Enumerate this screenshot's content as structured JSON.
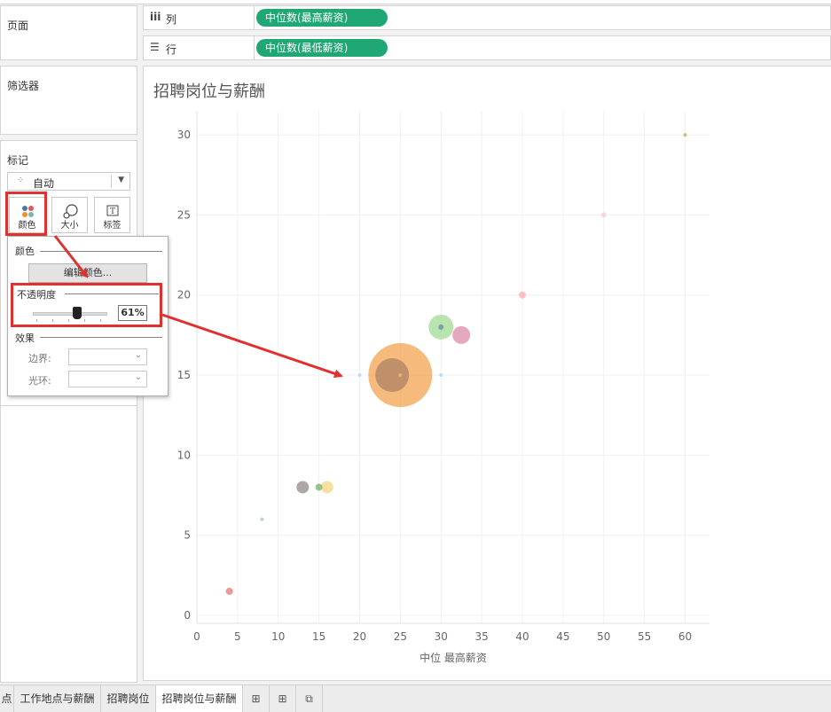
{
  "sidebar": {
    "pages_title": "页面",
    "filters_title": "筛选器",
    "marks_title": "标记",
    "mark_type": "自动",
    "buttons": [
      {
        "label": "颜色",
        "icon": "color-dots-icon"
      },
      {
        "label": "大小",
        "icon": "size-icon"
      },
      {
        "label": "标签",
        "icon": "label-T-icon"
      }
    ]
  },
  "shelves": {
    "columns": {
      "label": "列",
      "icon": "columns-icon",
      "pill": "中位数(最高薪资)"
    },
    "rows": {
      "label": "行",
      "icon": "rows-icon",
      "pill": "中位数(最低薪资)"
    }
  },
  "color_popup": {
    "color_section": "颜色",
    "edit_colors_button": "编辑颜色...",
    "opacity_section": "不透明度",
    "opacity_value": "61%",
    "opacity_fraction": 0.61,
    "effects_section": "效果",
    "border_label": "边界:",
    "halo_label": "光环:"
  },
  "chart_data": {
    "type": "scatter",
    "title": "招聘岗位与薪酬",
    "xlabel": "中位 最高薪资",
    "ylabel": "",
    "xlim": [
      0,
      63
    ],
    "ylim": [
      -0.5,
      31.5
    ],
    "xticks": [
      0,
      5,
      10,
      15,
      20,
      25,
      30,
      35,
      40,
      45,
      50,
      55,
      60
    ],
    "yticks": [
      0,
      5,
      10,
      15,
      20,
      25,
      30
    ],
    "grid": true,
    "opacity": 0.61,
    "points": [
      {
        "x": 25,
        "y": 15,
        "size": 36,
        "color": "#f28e2b"
      },
      {
        "x": 24,
        "y": 15,
        "size": 19,
        "color": "#9c755f"
      },
      {
        "x": 30,
        "y": 18,
        "size": 14,
        "color": "#8cd17d"
      },
      {
        "x": 32.5,
        "y": 17.5,
        "size": 10,
        "color": "#d37295"
      },
      {
        "x": 30,
        "y": 18,
        "size": 3,
        "color": "#4e79a7"
      },
      {
        "x": 20,
        "y": 15,
        "size": 2,
        "color": "#a0cbe8"
      },
      {
        "x": 30,
        "y": 15,
        "size": 2,
        "color": "#a0cbe8"
      },
      {
        "x": 25,
        "y": 15,
        "size": 2,
        "color": "#f1ce63"
      },
      {
        "x": 13,
        "y": 8,
        "size": 7,
        "color": "#79706e"
      },
      {
        "x": 16,
        "y": 8,
        "size": 7,
        "color": "#f1ce63"
      },
      {
        "x": 15,
        "y": 8,
        "size": 4,
        "color": "#59a14f"
      },
      {
        "x": 4,
        "y": 1.5,
        "size": 4,
        "color": "#e15759"
      },
      {
        "x": 8,
        "y": 6,
        "size": 2,
        "color": "#86bcb6"
      },
      {
        "x": 40,
        "y": 20,
        "size": 4,
        "color": "#ff9d9a"
      },
      {
        "x": 50,
        "y": 25,
        "size": 3,
        "color": "#fabfd2"
      },
      {
        "x": 60,
        "y": 30,
        "size": 2,
        "color": "#b6992d"
      }
    ]
  },
  "bottom_tabs": [
    "点",
    "工作地点与薪酬",
    "招聘岗位",
    "招聘岗位与薪酬"
  ],
  "active_tab": "招聘岗位与薪酬",
  "bottom_icons": [
    "new-worksheet-icon",
    "new-dashboard-icon",
    "new-story-icon"
  ]
}
